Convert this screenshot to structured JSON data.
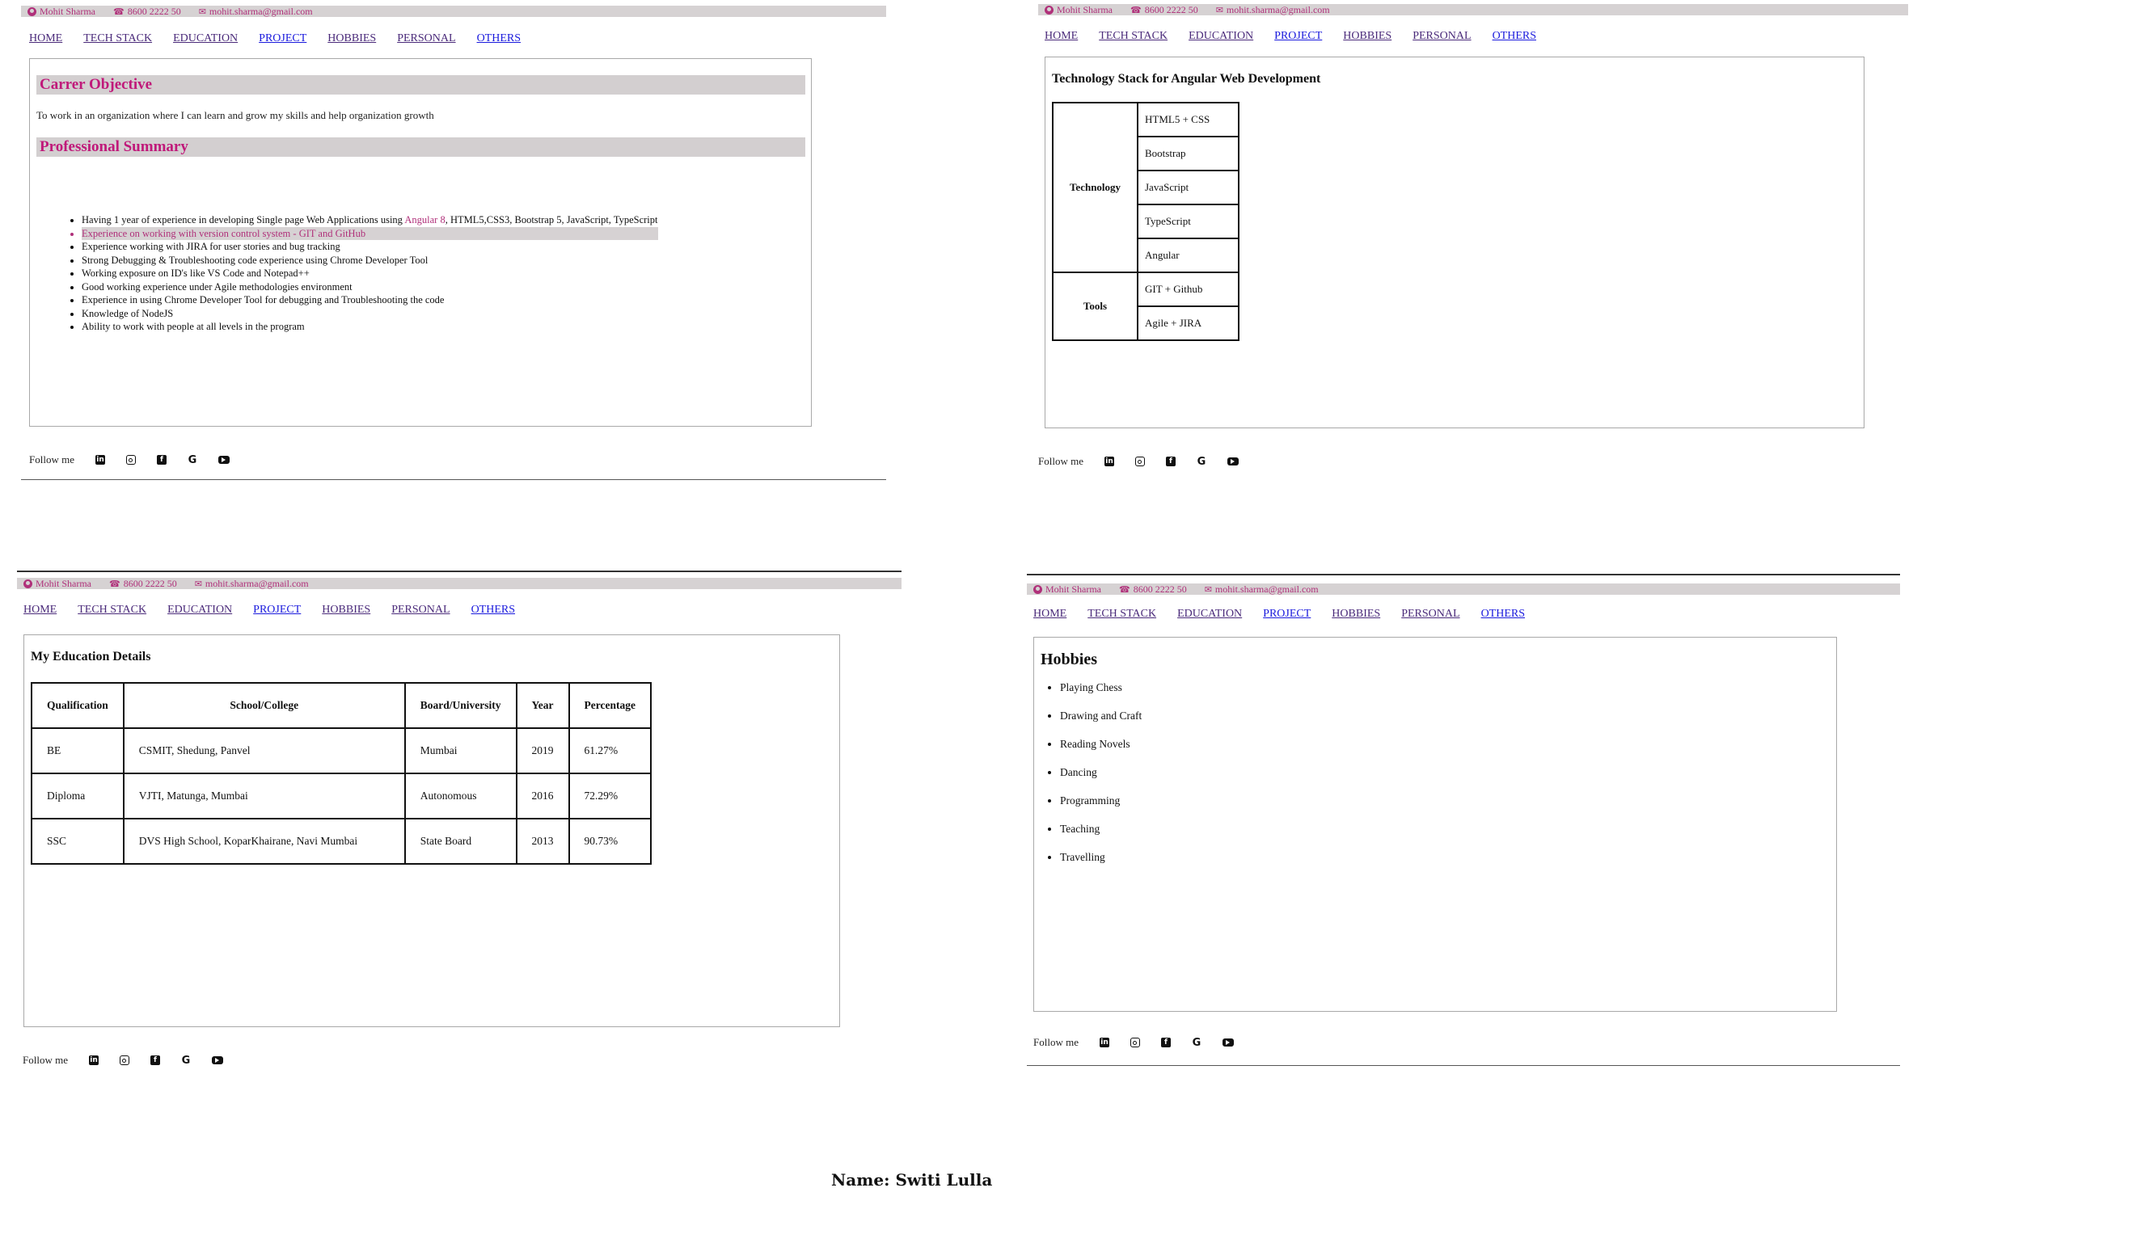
{
  "header": {
    "name": "Mohit Sharma",
    "phone": "8600 2222 50",
    "email": "mohit.sharma@gmail.com",
    "name_icon": "user-circle-icon",
    "phone_icon": "phone-icon",
    "email_icon": "envelope-icon"
  },
  "nav": {
    "items": [
      "HOME",
      "TECH STACK",
      "EDUCATION",
      "PROJECT",
      "HOBBIES",
      "PERSONAL",
      "OTHERS"
    ]
  },
  "footer": {
    "follow_label": "Follow me",
    "social_icons": [
      "linkedin-icon",
      "instagram-icon",
      "facebook-icon",
      "google-icon",
      "youtube-icon"
    ]
  },
  "panel1": {
    "objective_title": "Carrer Objective",
    "objective_text": "To work in an organization where I can learn and grow my skills and help organization growth",
    "summary_title": "Professional Summary",
    "summary_items": [
      "Having 1 year of experience in developing Single page Web Applications using",
      "Experience on working with version control system - GIT and GitHub",
      "Experience working with JIRA for user stories and bug tracking",
      "Strong Debugging & Troubleshooting code experience using Chrome Developer Tool",
      "Working exposure on ID's like VS Code and Notepad++",
      "Good working experience under Agile methodologies environment",
      "Experience in using Chrome Developer Tool for debugging and Troubleshooting the code",
      "Knowledge of NodeJS",
      "Ability to work with people at all levels in the program"
    ],
    "summary_item1_highlight": "Angular 8",
    "summary_item1_tail": ", HTML5,CSS3, Bootstrap 5, JavaScript, TypeScript"
  },
  "panel2": {
    "title": "Technology Stack for Angular Web Development",
    "technology_label": "Technology",
    "technology_items": [
      "HTML5 + CSS",
      "Bootstrap",
      "JavaScript",
      "TypeScript",
      "Angular"
    ],
    "tools_label": "Tools",
    "tools_items": [
      "GIT + Github",
      "Agile + JIRA"
    ]
  },
  "panel3": {
    "title": "My Education Details",
    "columns": [
      "Qualification",
      "School/College",
      "Board/University",
      "Year",
      "Percentage"
    ],
    "rows": [
      [
        "BE",
        "CSMIT, Shedung, Panvel",
        "Mumbai",
        "2019",
        "61.27%"
      ],
      [
        "Diploma",
        "VJTI, Matunga, Mumbai",
        "Autonomous",
        "2016",
        "72.29%"
      ],
      [
        "SSC",
        "DVS High School, KoparKhairane, Navi Mumbai",
        "State Board",
        "2013",
        "90.73%"
      ]
    ]
  },
  "panel4": {
    "title": "Hobbies",
    "items": [
      "Playing Chess",
      "Drawing and Craft",
      "Reading Novels",
      "Dancing",
      "Programming",
      "Teaching",
      "Travelling"
    ]
  },
  "footer_name": "Name: Switi Lulla",
  "colors": {
    "accent": "#b0307a",
    "bar": "#d6d2d3",
    "link": "#1a1add"
  }
}
